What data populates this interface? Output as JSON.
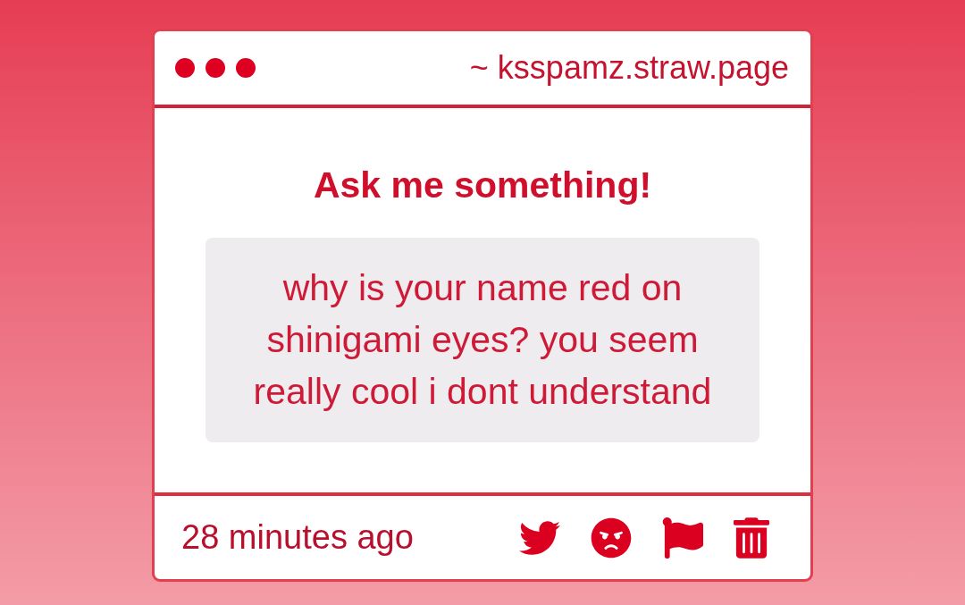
{
  "window": {
    "url": "~ ksspamz.straw.page"
  },
  "prompt": {
    "title": "Ask me something!"
  },
  "question": {
    "text": "why is your name red on shinigami eyes? you seem really cool i dont understand"
  },
  "footer": {
    "time": "28 minutes ago",
    "actions": [
      {
        "kind": "share"
      },
      {
        "kind": "react"
      },
      {
        "kind": "report"
      },
      {
        "kind": "delete"
      }
    ]
  }
}
